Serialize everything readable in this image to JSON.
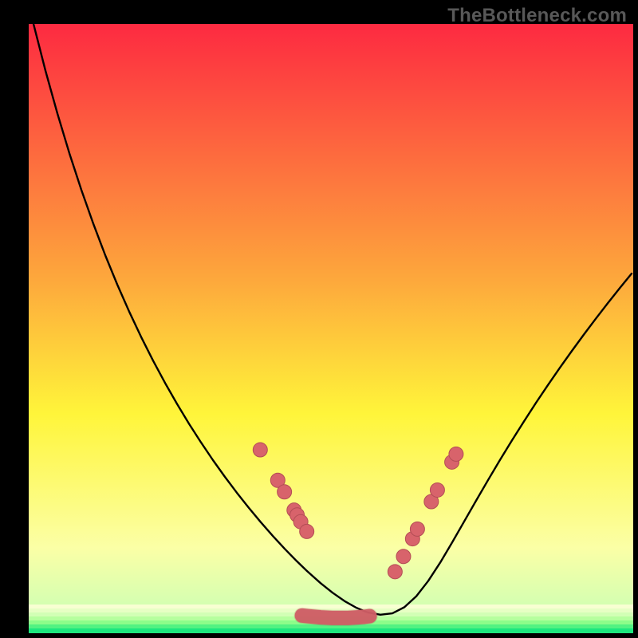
{
  "watermark": "TheBottleneck.com",
  "colors": {
    "gradient_top": "#fd2a41",
    "gradient_mid1": "#fda83c",
    "gradient_mid2": "#fff53a",
    "gradient_mid3": "#fbffa6",
    "gradient_bottom": "#1ce77e",
    "curve": "#000000",
    "dot_fill": "#d8636b",
    "dot_stroke": "#b34d55"
  },
  "chart_data": {
    "type": "line",
    "title": "",
    "xlabel": "",
    "ylabel": "",
    "xlim": [
      0,
      100
    ],
    "ylim": [
      0,
      100
    ],
    "curve": {
      "x": [
        0.79,
        2.77,
        4.75,
        6.73,
        8.71,
        10.69,
        12.66,
        14.64,
        16.62,
        18.6,
        20.58,
        22.56,
        24.54,
        26.52,
        28.5,
        30.47,
        32.45,
        34.43,
        36.41,
        38.39,
        40.37,
        42.35,
        44.33,
        45.91,
        46.31,
        48.28,
        50.26,
        52.24,
        54.22,
        55.8,
        56.2,
        58.18,
        60.16,
        62.14,
        64.12,
        66.09,
        68.07,
        70.05,
        72.03,
        74.01,
        75.99,
        77.97,
        79.95,
        81.93,
        83.9,
        85.88,
        87.86,
        89.84,
        91.82,
        93.8,
        95.78,
        97.76,
        99.74
      ],
      "y": [
        100.0,
        92.34,
        85.28,
        78.77,
        72.76,
        67.2,
        62.04,
        57.25,
        52.79,
        48.62,
        44.72,
        41.07,
        37.63,
        34.38,
        31.32,
        28.42,
        25.67,
        23.06,
        20.58,
        18.22,
        15.98,
        13.85,
        11.84,
        10.33,
        9.96,
        8.22,
        6.65,
        5.28,
        4.17,
        3.52,
        3.39,
        3.04,
        3.27,
        4.27,
        6.07,
        8.58,
        11.59,
        14.9,
        18.33,
        21.76,
        25.14,
        28.45,
        31.66,
        34.77,
        37.79,
        40.72,
        43.56,
        46.32,
        49.0,
        51.61,
        54.15,
        56.62,
        59.03
      ]
    },
    "bottom_band": {
      "x": [
        45.2,
        46.1,
        48.3,
        50.2,
        51.8,
        52.8,
        54.4,
        55.6,
        56.4
      ],
      "y": [
        2.9,
        2.8,
        2.6,
        2.5,
        2.5,
        2.5,
        2.6,
        2.7,
        2.8
      ]
    },
    "dots_left": {
      "x": [
        38.3,
        41.2,
        42.3,
        43.9,
        44.4,
        45.0,
        46.0
      ],
      "y": [
        30.1,
        25.1,
        23.2,
        20.2,
        19.4,
        18.3,
        16.7
      ]
    },
    "dots_right": {
      "x": [
        60.6,
        62.0,
        63.5,
        64.3,
        66.6,
        67.6,
        70.0,
        70.7
      ],
      "y": [
        10.1,
        12.6,
        15.5,
        17.1,
        21.6,
        23.5,
        28.1,
        29.4
      ]
    }
  }
}
